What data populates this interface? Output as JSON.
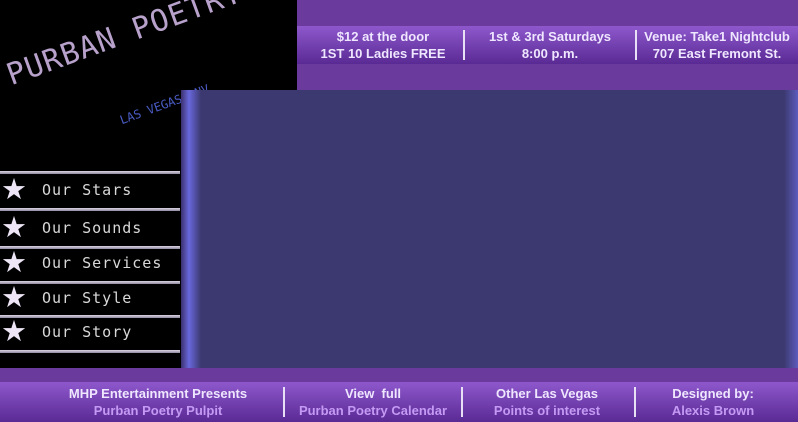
{
  "logo": {
    "title": "PURBAN POETRY PULPIT",
    "subtitle": "LAS VEGAS, NV"
  },
  "top_info": {
    "cells": [
      {
        "line1": "$12 at the door",
        "line2": "1ST 10 Ladies FREE"
      },
      {
        "line1": "1st & 3rd Saturdays",
        "line2": "8:00 p.m."
      },
      {
        "line1": "Venue: Take1 Nightclub",
        "line2": "707 East Fremont St."
      }
    ]
  },
  "nav": {
    "icon": "star-icon",
    "items": [
      {
        "label": "Our Stars"
      },
      {
        "label": "Our Sounds"
      },
      {
        "label": "Our Services"
      },
      {
        "label": "Our Style"
      },
      {
        "label": "Our Story"
      }
    ]
  },
  "footer": {
    "cells": [
      {
        "line1": "MHP Entertainment Presents",
        "line2": "Purban Poetry Pulpit"
      },
      {
        "line1": "View  full",
        "line2": "Purban Poetry Calendar"
      },
      {
        "line1": "Other Las Vegas",
        "line2": "Points of interest"
      },
      {
        "line1": "Designed by:",
        "line2": "Alexis Brown"
      }
    ]
  },
  "colors": {
    "background": "#6a3a9c",
    "bar_top": "#8e58cc",
    "bar_bottom": "#5a2a94",
    "content_panel": "#3c3970",
    "sidebar": "#000000",
    "logo_title": "#b8a2cc",
    "logo_subtitle": "#4a5cc6"
  }
}
